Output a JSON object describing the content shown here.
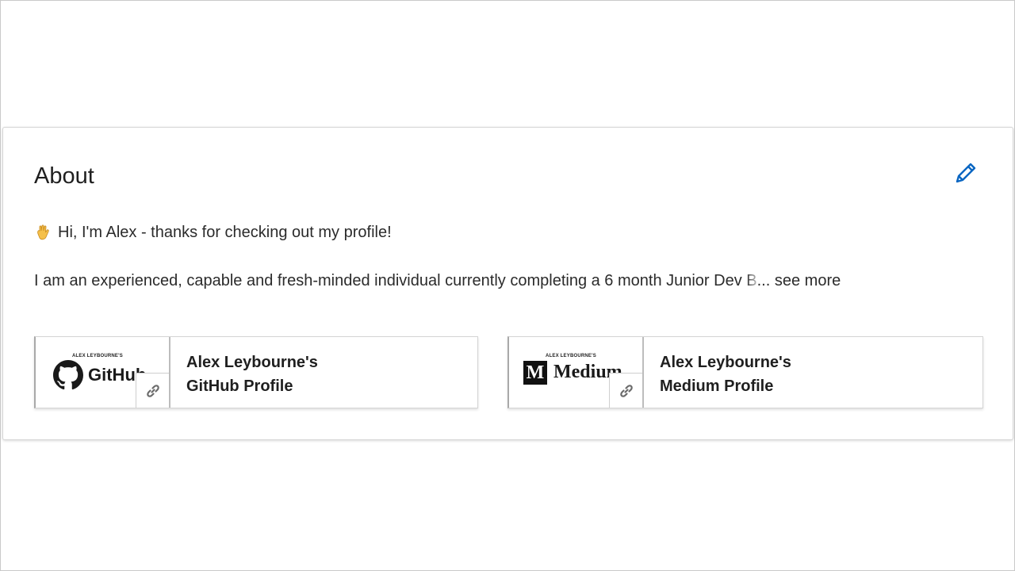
{
  "about": {
    "title": "About",
    "edit_icon": "pencil-icon",
    "accent_color": "#0a66c2",
    "greeting_emoji": "waving-hand-icon",
    "greeting": "Hi, I'm Alex - thanks for checking out my profile!",
    "summary_visible": "I am an experienced, capable and fresh-minded individual currently completing a 6 month Junior Dev ",
    "summary_faded": "B",
    "summary_ellipsis": "...",
    "see_more": "see more"
  },
  "media": [
    {
      "thumb_caption": "ALEX LEYBOURNE'S",
      "thumb_brand": "GitHub",
      "thumb_icon": "github-logo-icon",
      "title_line1": "Alex Leybourne's",
      "title_line2": "GitHub Profile",
      "link_icon": "link-icon"
    },
    {
      "thumb_caption": "ALEX LEYBOURNE'S",
      "thumb_brand": "Medium",
      "thumb_logo_letter": "M",
      "thumb_icon": "medium-logo-icon",
      "title_line1": "Alex Leybourne's",
      "title_line2": "Medium Profile",
      "link_icon": "link-icon"
    }
  ]
}
